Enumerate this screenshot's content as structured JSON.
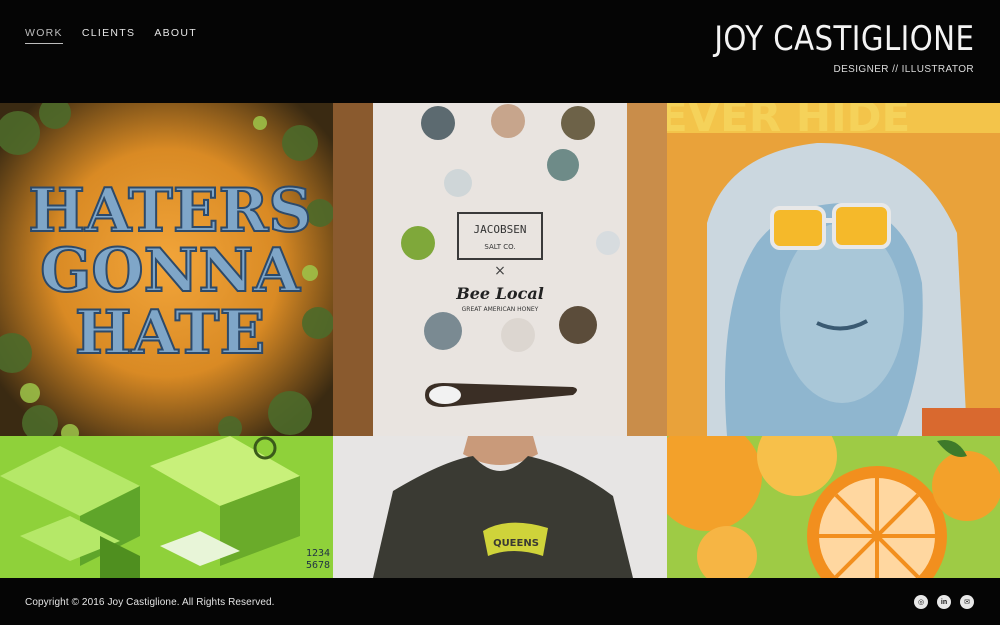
{
  "nav": {
    "items": [
      {
        "label": "WORK"
      },
      {
        "label": "CLIENTS"
      },
      {
        "label": "ABOUT"
      }
    ]
  },
  "brand": {
    "name": "JOY CASTIGLIONE",
    "subtitle": "DESIGNER // ILLUSTRATOR"
  },
  "portfolio": {
    "haters": {
      "line1": "HATERS",
      "line2": "GONNA",
      "line3": "HATE"
    },
    "salt": {
      "brand_top": "JACOBSEN",
      "brand_bottom": "SALT CO.",
      "cross": "×",
      "bee": "Bee Local",
      "bee_sub": "GREAT AMERICAN HONEY"
    },
    "poster": {
      "headline": "NEVER HIDE"
    },
    "iso": {
      "numbers": "1234\n5678"
    },
    "shirt": {
      "print_text": "QUEENS"
    }
  },
  "footer": {
    "copyright": "Copyright © 2016 Joy Castiglione. All Rights Reserved.",
    "social": [
      {
        "icon": "instagram-icon",
        "glyph": "◎"
      },
      {
        "icon": "linkedin-icon",
        "glyph": "in"
      },
      {
        "icon": "email-icon",
        "glyph": "✉"
      }
    ]
  },
  "colors": {
    "background": "#050505",
    "text": "#f4f4f4"
  }
}
